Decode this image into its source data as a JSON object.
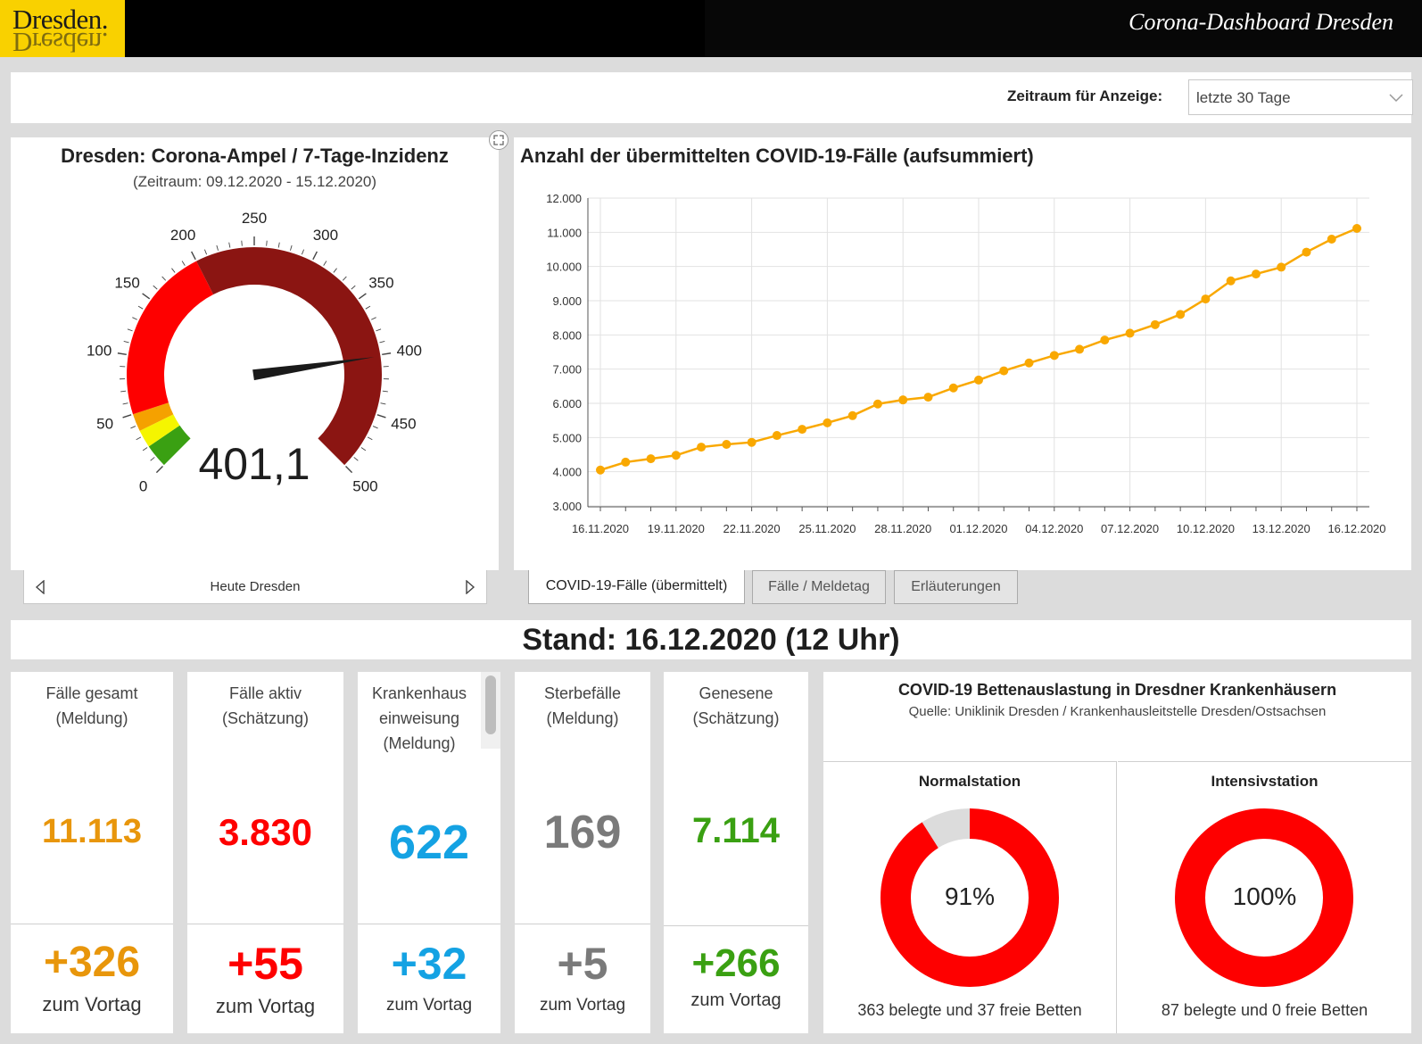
{
  "header": {
    "logo_text": "Dresden.",
    "title": "Corona-Dashboard Dresden"
  },
  "filter": {
    "label": "Zeitraum für Anzeige:",
    "selected": "letzte 30 Tage"
  },
  "gauge": {
    "title": "Dresden: Corona-Ampel / 7-Tage-Inzidenz",
    "subtitle": "(Zeitraum: 09.12.2020 - 15.12.2020)",
    "value": 401.1,
    "value_label": "401,1",
    "max": 500,
    "ticks": [
      "0",
      "50",
      "100",
      "150",
      "200",
      "250",
      "300",
      "350",
      "400",
      "450",
      "500"
    ],
    "bands": [
      {
        "from": 0,
        "to": 20,
        "color": "#3aa012"
      },
      {
        "from": 20,
        "to": 35,
        "color": "#f5f500"
      },
      {
        "from": 35,
        "to": 50,
        "color": "#f5a100"
      },
      {
        "from": 50,
        "to": 200,
        "color": "#fe0000"
      },
      {
        "from": 200,
        "to": 500,
        "color": "#8b1512"
      }
    ],
    "nav_label": "Heute Dresden"
  },
  "chart": {
    "title": "Anzahl der übermittelten COVID-19-Fälle (aufsummiert)",
    "tabs": [
      "COVID-19-Fälle (übermittelt)",
      "Fälle / Meldetag",
      "Erläuterungen"
    ],
    "line_color": "#f9a800"
  },
  "chart_data": {
    "type": "line",
    "title": "Anzahl der übermittelten COVID-19-Fälle (aufsummiert)",
    "x": [
      "16.11.2020",
      "17.11.2020",
      "18.11.2020",
      "19.11.2020",
      "20.11.2020",
      "21.11.2020",
      "22.11.2020",
      "23.11.2020",
      "24.11.2020",
      "25.11.2020",
      "26.11.2020",
      "27.11.2020",
      "28.11.2020",
      "29.11.2020",
      "30.11.2020",
      "01.12.2020",
      "02.12.2020",
      "03.12.2020",
      "04.12.2020",
      "05.12.2020",
      "06.12.2020",
      "07.12.2020",
      "08.12.2020",
      "09.12.2020",
      "10.12.2020",
      "11.12.2020",
      "12.12.2020",
      "13.12.2020",
      "14.12.2020",
      "15.12.2020",
      "16.12.2020"
    ],
    "x_tick_labels": [
      "16.11.2020",
      "19.11.2020",
      "22.11.2020",
      "25.11.2020",
      "28.11.2020",
      "01.12.2020",
      "04.12.2020",
      "07.12.2020",
      "10.12.2020",
      "13.12.2020",
      "16.12.2020"
    ],
    "series": [
      {
        "values": [
          4050,
          4280,
          4380,
          4480,
          4720,
          4800,
          4860,
          5060,
          5240,
          5430,
          5640,
          5980,
          6100,
          6180,
          6450,
          6680,
          6950,
          7180,
          7400,
          7580,
          7850,
          8050,
          8300,
          8600,
          9050,
          9580,
          9780,
          9980,
          10420,
          10800,
          11113
        ]
      }
    ],
    "ylim": [
      3000,
      12000
    ],
    "y_tick_labels": [
      "3.000",
      "4.000",
      "5.000",
      "6.000",
      "7.000",
      "8.000",
      "9.000",
      "10.000",
      "11.000",
      "12.000"
    ],
    "grid": true
  },
  "stand": "Stand: 16.12.2020 (12 Uhr)",
  "kpis": [
    {
      "label1": "Fälle gesamt",
      "label2": "(Meldung)",
      "label3": "",
      "value": "11.113",
      "delta": "+326",
      "foot": "zum Vortag",
      "color": "#e8960b"
    },
    {
      "label1": "Fälle aktiv",
      "label2": "(Schätzung)",
      "label3": "",
      "value": "3.830",
      "delta": "+55",
      "foot": "zum Vortag",
      "color": "#fe0000"
    },
    {
      "label1": "Krankenhaus",
      "label2": "einweisung",
      "label3": "(Meldung)",
      "value": "622",
      "delta": "+32",
      "foot": "zum Vortag",
      "color": "#14a2e3"
    },
    {
      "label1": "Sterbefälle",
      "label2": "(Meldung)",
      "label3": "",
      "value": "169",
      "delta": "+5",
      "foot": "zum Vortag",
      "color": "#7a7a7a"
    },
    {
      "label1": "Genesene",
      "label2": "(Schätzung)",
      "label3": "",
      "value": "7.114",
      "delta": "+266",
      "foot": "zum Vortag",
      "color": "#3aa012"
    }
  ],
  "beds": {
    "title": "COVID-19 Bettenauslastung in Dresdner Krankenhäusern",
    "subtitle": "Quelle: Uniklinik Dresden / Krankenhausleitstelle Dresden/Ostsachsen",
    "normal": {
      "name": "Normalstation",
      "percent": 91,
      "label": "91%",
      "foot": "363 belegte und 37 freie Betten"
    },
    "icu": {
      "name": "Intensivstation",
      "percent": 100,
      "label": "100%",
      "foot": "87 belegte und 0 freie Betten"
    },
    "used_color": "#fe0000",
    "free_color": "#dcdcdc"
  }
}
